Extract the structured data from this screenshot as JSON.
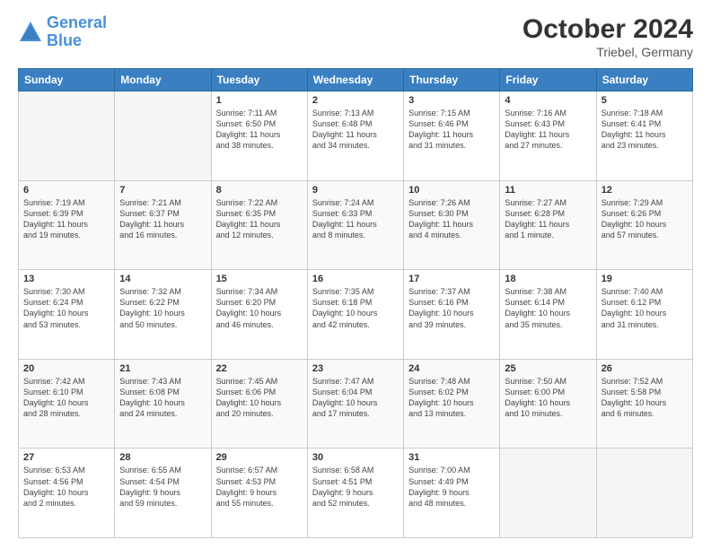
{
  "header": {
    "logo_line1": "General",
    "logo_line2": "Blue",
    "title": "October 2024",
    "subtitle": "Triebel, Germany"
  },
  "days_of_week": [
    "Sunday",
    "Monday",
    "Tuesday",
    "Wednesday",
    "Thursday",
    "Friday",
    "Saturday"
  ],
  "weeks": [
    [
      {
        "day": "",
        "info": ""
      },
      {
        "day": "",
        "info": ""
      },
      {
        "day": "1",
        "info": "Sunrise: 7:11 AM\nSunset: 6:50 PM\nDaylight: 11 hours\nand 38 minutes."
      },
      {
        "day": "2",
        "info": "Sunrise: 7:13 AM\nSunset: 6:48 PM\nDaylight: 11 hours\nand 34 minutes."
      },
      {
        "day": "3",
        "info": "Sunrise: 7:15 AM\nSunset: 6:46 PM\nDaylight: 11 hours\nand 31 minutes."
      },
      {
        "day": "4",
        "info": "Sunrise: 7:16 AM\nSunset: 6:43 PM\nDaylight: 11 hours\nand 27 minutes."
      },
      {
        "day": "5",
        "info": "Sunrise: 7:18 AM\nSunset: 6:41 PM\nDaylight: 11 hours\nand 23 minutes."
      }
    ],
    [
      {
        "day": "6",
        "info": "Sunrise: 7:19 AM\nSunset: 6:39 PM\nDaylight: 11 hours\nand 19 minutes."
      },
      {
        "day": "7",
        "info": "Sunrise: 7:21 AM\nSunset: 6:37 PM\nDaylight: 11 hours\nand 16 minutes."
      },
      {
        "day": "8",
        "info": "Sunrise: 7:22 AM\nSunset: 6:35 PM\nDaylight: 11 hours\nand 12 minutes."
      },
      {
        "day": "9",
        "info": "Sunrise: 7:24 AM\nSunset: 6:33 PM\nDaylight: 11 hours\nand 8 minutes."
      },
      {
        "day": "10",
        "info": "Sunrise: 7:26 AM\nSunset: 6:30 PM\nDaylight: 11 hours\nand 4 minutes."
      },
      {
        "day": "11",
        "info": "Sunrise: 7:27 AM\nSunset: 6:28 PM\nDaylight: 11 hours\nand 1 minute."
      },
      {
        "day": "12",
        "info": "Sunrise: 7:29 AM\nSunset: 6:26 PM\nDaylight: 10 hours\nand 57 minutes."
      }
    ],
    [
      {
        "day": "13",
        "info": "Sunrise: 7:30 AM\nSunset: 6:24 PM\nDaylight: 10 hours\nand 53 minutes."
      },
      {
        "day": "14",
        "info": "Sunrise: 7:32 AM\nSunset: 6:22 PM\nDaylight: 10 hours\nand 50 minutes."
      },
      {
        "day": "15",
        "info": "Sunrise: 7:34 AM\nSunset: 6:20 PM\nDaylight: 10 hours\nand 46 minutes."
      },
      {
        "day": "16",
        "info": "Sunrise: 7:35 AM\nSunset: 6:18 PM\nDaylight: 10 hours\nand 42 minutes."
      },
      {
        "day": "17",
        "info": "Sunrise: 7:37 AM\nSunset: 6:16 PM\nDaylight: 10 hours\nand 39 minutes."
      },
      {
        "day": "18",
        "info": "Sunrise: 7:38 AM\nSunset: 6:14 PM\nDaylight: 10 hours\nand 35 minutes."
      },
      {
        "day": "19",
        "info": "Sunrise: 7:40 AM\nSunset: 6:12 PM\nDaylight: 10 hours\nand 31 minutes."
      }
    ],
    [
      {
        "day": "20",
        "info": "Sunrise: 7:42 AM\nSunset: 6:10 PM\nDaylight: 10 hours\nand 28 minutes."
      },
      {
        "day": "21",
        "info": "Sunrise: 7:43 AM\nSunset: 6:08 PM\nDaylight: 10 hours\nand 24 minutes."
      },
      {
        "day": "22",
        "info": "Sunrise: 7:45 AM\nSunset: 6:06 PM\nDaylight: 10 hours\nand 20 minutes."
      },
      {
        "day": "23",
        "info": "Sunrise: 7:47 AM\nSunset: 6:04 PM\nDaylight: 10 hours\nand 17 minutes."
      },
      {
        "day": "24",
        "info": "Sunrise: 7:48 AM\nSunset: 6:02 PM\nDaylight: 10 hours\nand 13 minutes."
      },
      {
        "day": "25",
        "info": "Sunrise: 7:50 AM\nSunset: 6:00 PM\nDaylight: 10 hours\nand 10 minutes."
      },
      {
        "day": "26",
        "info": "Sunrise: 7:52 AM\nSunset: 5:58 PM\nDaylight: 10 hours\nand 6 minutes."
      }
    ],
    [
      {
        "day": "27",
        "info": "Sunrise: 6:53 AM\nSunset: 4:56 PM\nDaylight: 10 hours\nand 2 minutes."
      },
      {
        "day": "28",
        "info": "Sunrise: 6:55 AM\nSunset: 4:54 PM\nDaylight: 9 hours\nand 59 minutes."
      },
      {
        "day": "29",
        "info": "Sunrise: 6:57 AM\nSunset: 4:53 PM\nDaylight: 9 hours\nand 55 minutes."
      },
      {
        "day": "30",
        "info": "Sunrise: 6:58 AM\nSunset: 4:51 PM\nDaylight: 9 hours\nand 52 minutes."
      },
      {
        "day": "31",
        "info": "Sunrise: 7:00 AM\nSunset: 4:49 PM\nDaylight: 9 hours\nand 48 minutes."
      },
      {
        "day": "",
        "info": ""
      },
      {
        "day": "",
        "info": ""
      }
    ]
  ]
}
